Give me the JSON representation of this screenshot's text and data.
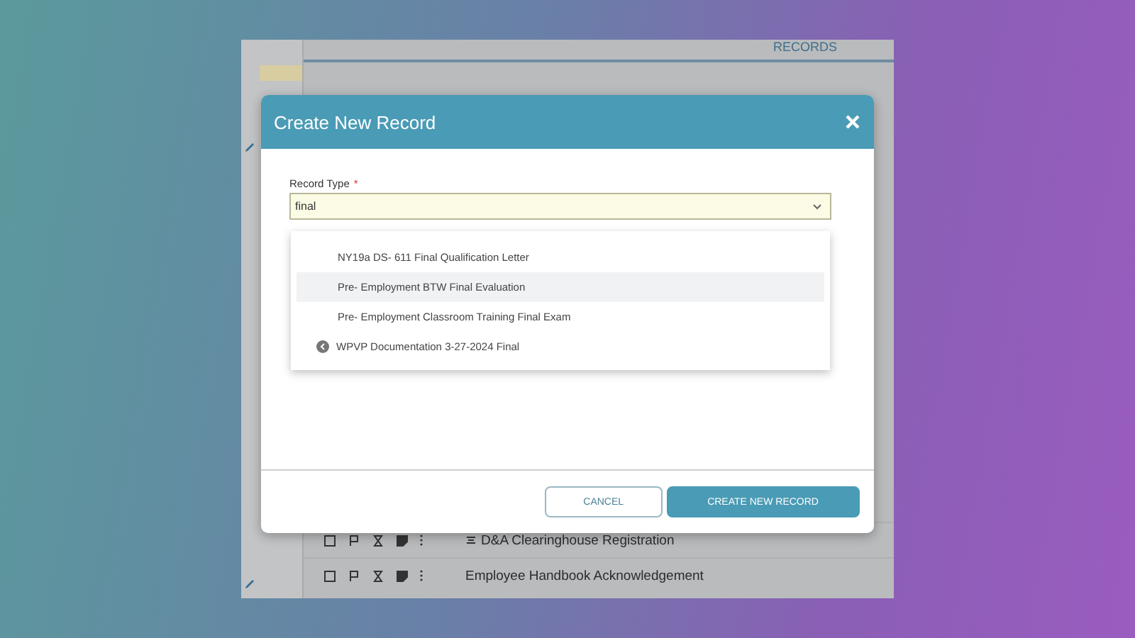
{
  "background_app": {
    "tab": "RECORDS",
    "rows": [
      {
        "title": "D&A Clearinghouse Registration",
        "kind": "grouped"
      },
      {
        "title": "Employee Handbook Acknowledgement",
        "kind": "plain"
      }
    ]
  },
  "dialog": {
    "title": "Create New Record",
    "field": {
      "label": "Record Type",
      "required_mark": "*",
      "value": "final"
    },
    "options": [
      {
        "label": "NY19a DS- 611 Final Qualification Letter",
        "selected": false,
        "kind": "plain"
      },
      {
        "label": "Pre- Employment BTW Final Evaluation",
        "selected": true,
        "kind": "plain"
      },
      {
        "label": "Pre- Employment Classroom Training Final Exam",
        "selected": false,
        "kind": "plain"
      },
      {
        "label": "WPVP Documentation 3-27-2024 Final",
        "selected": false,
        "kind": "linked"
      }
    ],
    "buttons": [
      {
        "label": "CANCEL",
        "kind": "secondary"
      },
      {
        "label": "CREATE NEW RECORD",
        "kind": "primary"
      }
    ]
  }
}
